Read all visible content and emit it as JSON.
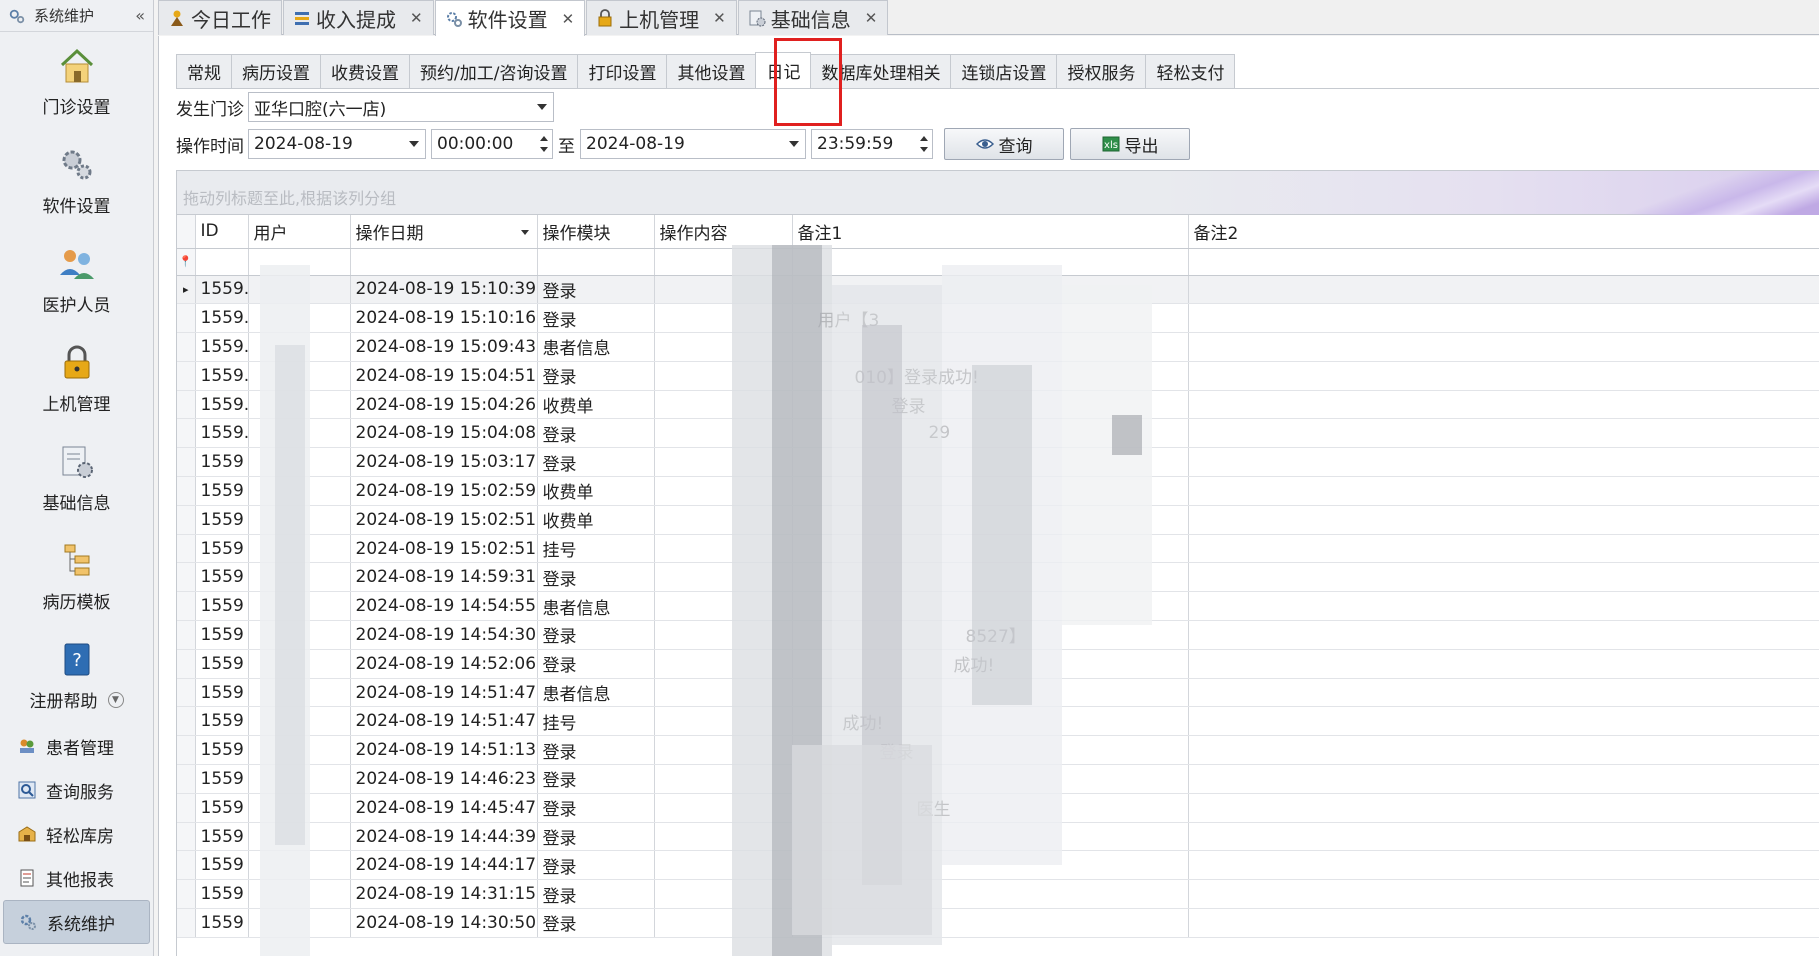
{
  "sidebar": {
    "header": "系统维护",
    "collapse": "«",
    "big_items": [
      {
        "label": "门诊设置",
        "icon": "house-icon"
      },
      {
        "label": "软件设置",
        "icon": "gears-icon"
      },
      {
        "label": "医护人员",
        "icon": "users-icon"
      },
      {
        "label": "上机管理",
        "icon": "lock-icon"
      },
      {
        "label": "基础信息",
        "icon": "info-gear-icon"
      },
      {
        "label": "病历模板",
        "icon": "template-tree-icon"
      },
      {
        "label": "注册帮助",
        "icon": "help-book-icon"
      }
    ],
    "list_items": [
      {
        "label": "患者管理",
        "icon": "patients-icon"
      },
      {
        "label": "查询服务",
        "icon": "query-icon"
      },
      {
        "label": "轻松库房",
        "icon": "warehouse-icon"
      },
      {
        "label": "其他报表",
        "icon": "report-icon"
      },
      {
        "label": "系统维护",
        "icon": "system-gear-icon"
      }
    ]
  },
  "top_tabs": [
    {
      "label": "今日工作",
      "closable": false
    },
    {
      "label": "收入提成",
      "closable": true
    },
    {
      "label": "软件设置",
      "closable": true,
      "active": true
    },
    {
      "label": "上机管理",
      "closable": true
    },
    {
      "label": "基础信息",
      "closable": true
    }
  ],
  "sub_tabs": [
    "常规",
    "病历设置",
    "收费设置",
    "预约/加工/咨询设置",
    "打印设置",
    "其他设置",
    "日记",
    "数据库处理相关",
    "连锁店设置",
    "授权服务",
    "轻松支付"
  ],
  "active_sub_tab": "日记",
  "filter": {
    "clinic_label": "发生门诊",
    "clinic_value": "亚华口腔(六一店)",
    "time_label": "操作时间",
    "date_from": "2024-08-19",
    "time_from": "00:00:00",
    "to_label": "至",
    "date_to": "2024-08-19",
    "time_to": "23:59:59",
    "query_button": "查询",
    "export_button": "导出"
  },
  "grid": {
    "group_hint": "拖动列标题至此,根据该列分组",
    "columns": [
      "ID",
      "用户",
      "操作日期",
      "操作模块",
      "操作内容",
      "备注1",
      "备注2"
    ],
    "rows": [
      {
        "id": "1559...",
        "date": "2024-08-19 15:10:39",
        "module": "登录"
      },
      {
        "id": "1559...",
        "date": "2024-08-19 15:10:16",
        "module": "登录"
      },
      {
        "id": "1559...",
        "date": "2024-08-19 15:09:43",
        "module": "患者信息"
      },
      {
        "id": "1559...",
        "date": "2024-08-19 15:04:51",
        "module": "登录"
      },
      {
        "id": "1559...",
        "date": "2024-08-19 15:04:26",
        "module": "收费单"
      },
      {
        "id": "1559...",
        "date": "2024-08-19 15:04:08",
        "module": "登录"
      },
      {
        "id": "1559",
        "date": "2024-08-19 15:03:17",
        "module": "登录"
      },
      {
        "id": "1559",
        "date": "2024-08-19 15:02:59",
        "module": "收费单"
      },
      {
        "id": "1559",
        "date": "2024-08-19 15:02:51",
        "module": "收费单"
      },
      {
        "id": "1559",
        "date": "2024-08-19 15:02:51",
        "module": "挂号"
      },
      {
        "id": "1559",
        "date": "2024-08-19 14:59:31",
        "module": "登录"
      },
      {
        "id": "1559",
        "date": "2024-08-19 14:54:55",
        "module": "患者信息"
      },
      {
        "id": "1559",
        "date": "2024-08-19 14:54:30",
        "module": "登录"
      },
      {
        "id": "1559",
        "date": "2024-08-19 14:52:06",
        "module": "登录"
      },
      {
        "id": "1559",
        "date": "2024-08-19 14:51:47",
        "module": "患者信息"
      },
      {
        "id": "1559",
        "date": "2024-08-19 14:51:47",
        "module": "挂号"
      },
      {
        "id": "1559",
        "date": "2024-08-19 14:51:13",
        "module": "登录"
      },
      {
        "id": "1559",
        "date": "2024-08-19 14:46:23",
        "module": "登录"
      },
      {
        "id": "1559",
        "date": "2024-08-19 14:45:47",
        "module": "登录"
      },
      {
        "id": "1559",
        "date": "2024-08-19 14:44:39",
        "module": "登录"
      },
      {
        "id": "1559",
        "date": "2024-08-19 14:44:17",
        "module": "登录"
      },
      {
        "id": "1559",
        "date": "2024-08-19 14:31:15",
        "module": "登录"
      },
      {
        "id": "1559",
        "date": "2024-08-19 14:30:50",
        "module": "登录"
      }
    ],
    "remark_fragments": [
      "用户【3",
      "010】登录成功!",
      "登录",
      "29",
      "8527】",
      "成功!",
      "登录",
      "医生",
      "成功!"
    ]
  },
  "colors": {
    "highlight": "#e0201f",
    "active_nav": "#c6d0dc"
  }
}
